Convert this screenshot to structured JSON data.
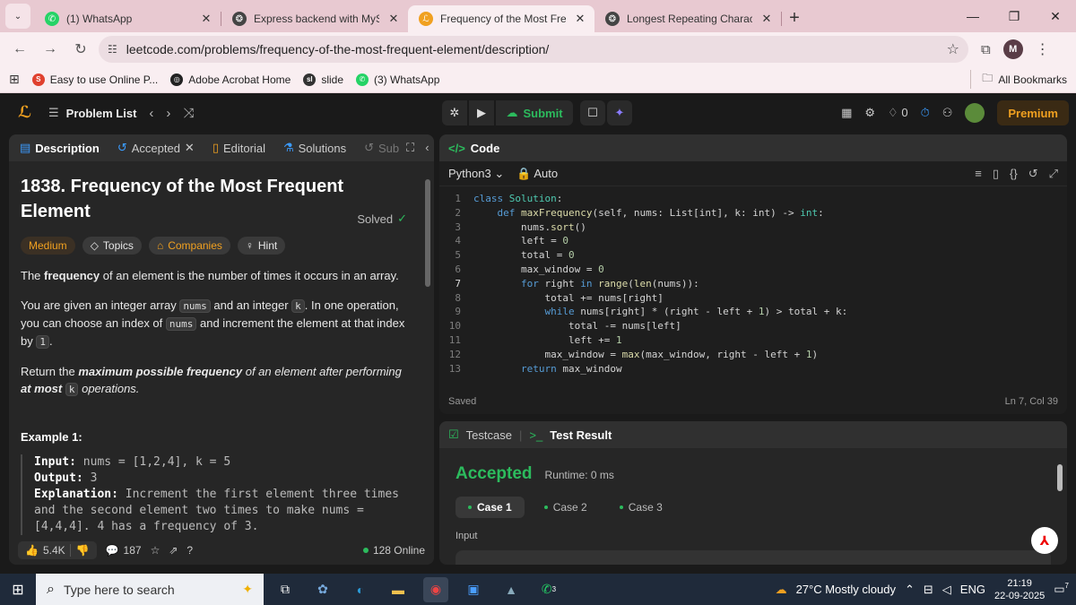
{
  "browser": {
    "tabs": [
      {
        "title": "(1) WhatsApp",
        "icon": "whatsapp-icon",
        "color": "#25d366",
        "active": false
      },
      {
        "title": "Express backend with MySQL",
        "icon": "chatgpt-icon",
        "color": "#444444",
        "active": false
      },
      {
        "title": "Frequency of the Most Frequent",
        "icon": "leetcode-icon",
        "color": "#f0a020",
        "active": true
      },
      {
        "title": "Longest Repeating Character Re",
        "icon": "chatgpt-icon",
        "color": "#444444",
        "active": false
      }
    ],
    "url": "leetcode.com/problems/frequency-of-the-most-frequent-element/description/",
    "profile_initial": "M",
    "bookmarks": [
      {
        "label": "Easy to use Online P...",
        "icon": "smallpdf-icon",
        "color": "#e0412f",
        "glyph": "S"
      },
      {
        "label": "Adobe Acrobat Home",
        "icon": "chatgpt-icon",
        "color": "#222222",
        "glyph": "◎"
      },
      {
        "label": "slide",
        "icon": "slide-icon",
        "color": "#333333",
        "glyph": "sl"
      },
      {
        "label": "(3) WhatsApp",
        "icon": "whatsapp-icon",
        "color": "#25d366",
        "glyph": "✆"
      }
    ],
    "all_bookmarks": "All Bookmarks"
  },
  "header": {
    "problem_list": "Problem List",
    "submit": "Submit",
    "fire_count": "0",
    "premium": "Premium"
  },
  "left": {
    "tabs": {
      "description": "Description",
      "accepted": "Accepted",
      "editorial": "Editorial",
      "solutions": "Solutions",
      "submissions": "Sub"
    },
    "title": "1838. Frequency of the Most Frequent Element",
    "solved": "Solved",
    "chips": {
      "difficulty": "Medium",
      "topics": "Topics",
      "companies": "Companies",
      "hint": "Hint"
    },
    "desc": {
      "p1_a": "The ",
      "p1_b": "frequency",
      "p1_c": " of an element is the number of times it occurs in an array.",
      "p2_a": "You are given an integer array ",
      "p2_nums": "nums",
      "p2_b": " and an integer ",
      "p2_k": "k",
      "p2_c": ". In one operation, you can choose an index of ",
      "p2_nums2": "nums",
      "p2_d": " and increment the element at that index by ",
      "p2_one": "1",
      "p2_e": ".",
      "p3_a": "Return the ",
      "p3_b": "maximum possible frequency",
      "p3_c": " of an element after performing ",
      "p3_d": "at most",
      "p3_k": "k",
      "p3_e": " operations."
    },
    "example_title": "Example 1:",
    "example": {
      "input_label": "Input:",
      "input_value": " nums = [1,2,4], k = 5",
      "output_label": "Output:",
      "output_value": " 3",
      "expl_label": "Explanation:",
      "expl_value": " Increment the first element three times and the second element two times to make nums = [4,4,4]. 4 has a frequency of 3."
    },
    "footer": {
      "likes": "5.4K",
      "comments": "187",
      "online": "128 Online"
    }
  },
  "code": {
    "tab": "Code",
    "language": "Python3",
    "mode": "Auto",
    "status": "Saved",
    "cursor": "Ln 7, Col 39",
    "current_line": 7
  },
  "test": {
    "tab_testcase": "Testcase",
    "tab_result": "Test Result",
    "verdict": "Accepted",
    "runtime": "Runtime: 0 ms",
    "cases": [
      "Case 1",
      "Case 2",
      "Case 3"
    ],
    "input_label": "Input"
  },
  "taskbar": {
    "search_placeholder": "Type here to search",
    "weather": "27°C  Mostly cloudy",
    "lang": "ENG",
    "time": "21:19",
    "date": "22-09-2025",
    "notif": "7",
    "whatsapp_badge": "3"
  }
}
